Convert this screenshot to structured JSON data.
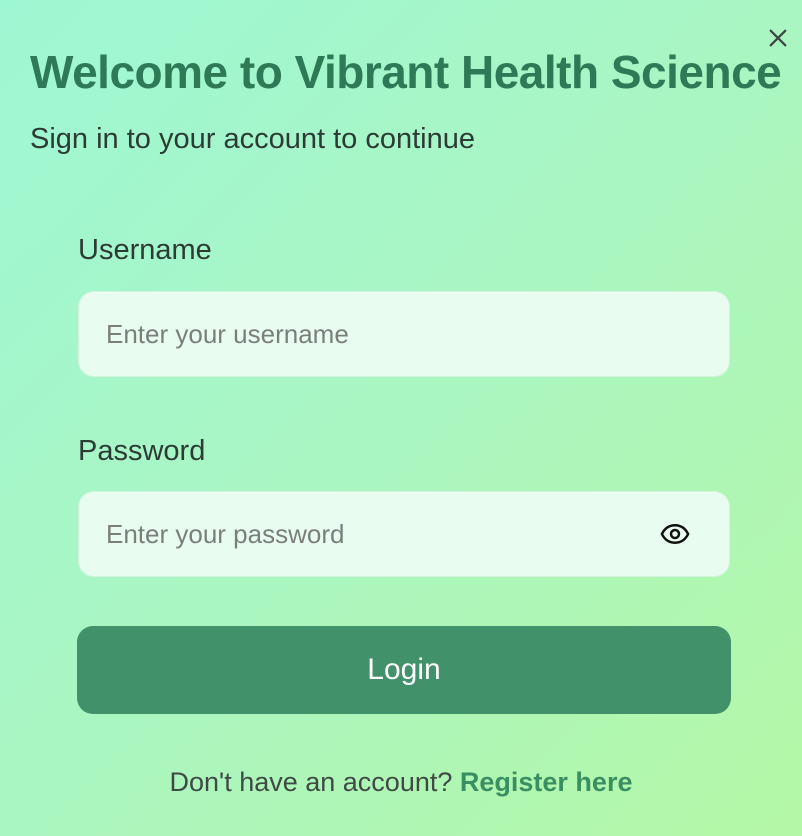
{
  "dialog": {
    "title": "Welcome to Vibrant Health Science",
    "subtitle": "Sign in to your account to continue",
    "close_icon": "close-icon"
  },
  "form": {
    "username": {
      "label": "Username",
      "placeholder": "Enter your username",
      "value": ""
    },
    "password": {
      "label": "Password",
      "placeholder": "Enter your password",
      "value": "",
      "toggle_icon": "eye-icon"
    },
    "login_label": "Login"
  },
  "footer": {
    "prompt": "Don't have an account?",
    "register_label": "Register here"
  },
  "colors": {
    "gradient_start": "#9ef7d3",
    "gradient_end": "#b4f7a6",
    "title": "#2f7a56",
    "button": "#41926b",
    "link": "#3a8f62",
    "input_bg": "#e8fdef"
  }
}
